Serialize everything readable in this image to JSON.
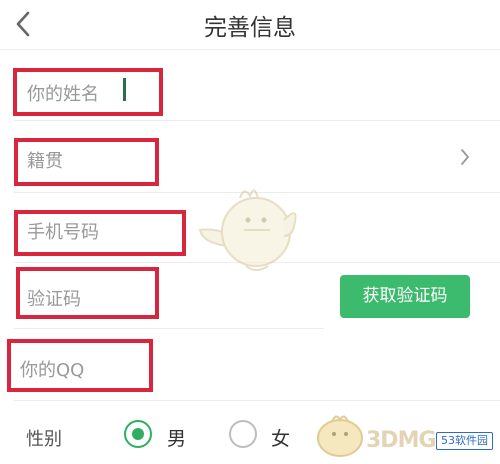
{
  "header": {
    "title": "完善信息",
    "back_icon": "chevron-left-icon"
  },
  "form": {
    "name_placeholder": "你的姓名",
    "native_place_placeholder": "籍贯",
    "phone_placeholder": "手机号码",
    "code_placeholder": "验证码",
    "get_code_label": "获取验证码",
    "qq_placeholder": "你的QQ",
    "gender_label": "性别",
    "gender_options": [
      "男",
      "女"
    ],
    "gender_selected": "男"
  },
  "watermark": {
    "text": "3DMG",
    "badge": "53软件园"
  },
  "colors": {
    "accent": "#3cbb6e",
    "highlight": "#d7263d"
  }
}
